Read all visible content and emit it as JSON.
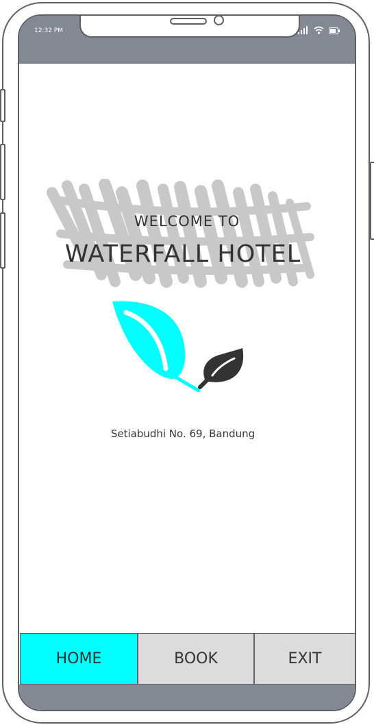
{
  "status_bar": {
    "time": "12:32 PM",
    "icons": [
      "signal-icon",
      "wifi-icon",
      "battery-icon"
    ]
  },
  "hero": {
    "welcome": "WELCOME TO",
    "hotel_name": "WATERFALL HOTEL",
    "logo_icon": "leaf-logo-icon"
  },
  "address": "Setiabudhi No. 69, Bandung",
  "nav": {
    "home": "HOME",
    "book": "BOOK",
    "exit": "EXIT",
    "active": "home"
  },
  "colors": {
    "accent": "#00ffff",
    "frame": "#838893",
    "button": "#dcdcdc",
    "text": "#333333"
  }
}
